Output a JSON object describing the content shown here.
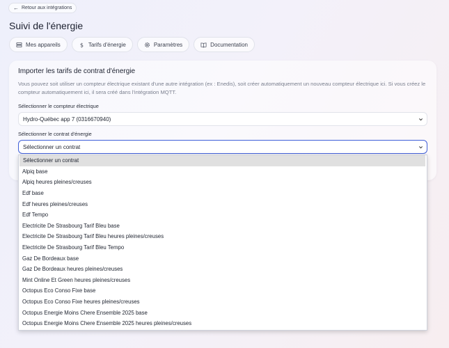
{
  "header": {
    "back_label": "Retour aux intégrations",
    "title": "Suivi de l'énergie"
  },
  "tabs": [
    {
      "label": "Mes appareils",
      "icon": "server-icon"
    },
    {
      "label": "Tarifs d'énergie",
      "icon": "dollar-icon"
    },
    {
      "label": "Paramètres",
      "icon": "gear-icon"
    },
    {
      "label": "Documentation",
      "icon": "book-icon"
    }
  ],
  "card": {
    "title": "Importer les tarifs de contrat d'énergie",
    "description": "Vous pouvez soit utiliser un compteur électrique existant d'une autre intégration (ex : Enedis), soit créer automatiquement un nouveau compteur électrique ici. Si vous créez le compteur automatiquement ici, il sera créé dans l'intégration MQTT.",
    "meter_label": "Sélectionner le compteur électrique",
    "meter_value": "Hydro-Québec app 7 (0316670940)",
    "contract_label": "Sélectionner le contrat d'énergie",
    "contract_value": "Sélectionner un contrat"
  },
  "dropdown": {
    "options": [
      "Sélectionner un contrat",
      "Alpiq base",
      "Alpiq heures pleines/creuses",
      "Edf base",
      "Edf heures pleines/creuses",
      "Edf Tempo",
      "Electricite De Strasbourg Tarif Bleu base",
      "Electricite De Strasbourg Tarif Bleu heures pleines/creuses",
      "Electricite De Strasbourg Tarif Bleu Tempo",
      "Gaz De Bordeaux base",
      "Gaz De Bordeaux heures pleines/creuses",
      "Mint Online Et Green heures pleines/creuses",
      "Octopus Eco Conso Fixe base",
      "Octopus Eco Conso Fixe heures pleines/creuses",
      "Octopus Energie Moins Chere Ensemble 2025 base",
      "Octopus Energie Moins Chere Ensemble 2025 heures pleines/creuses"
    ],
    "selected_index": 0
  },
  "colors": {
    "focus_border": "#3f5fd8",
    "selected_option_bg": "#e0e0e0"
  }
}
